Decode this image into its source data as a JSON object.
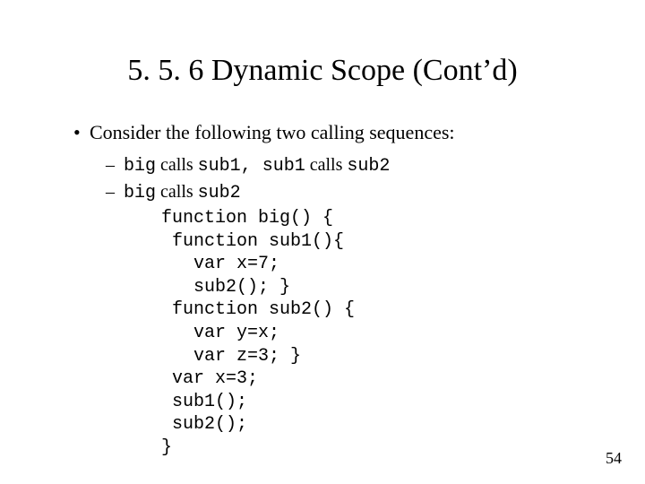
{
  "title": "5. 5. 6 Dynamic Scope (Cont’d)",
  "bullet": "Consider the following two calling sequences:",
  "seq1": {
    "a": "big",
    "calls1": " calls ",
    "b": "sub1",
    "comma": ", ",
    "c": "sub1",
    "calls2": " calls ",
    "d": "sub2"
  },
  "seq2": {
    "a": "big",
    "calls1": " calls ",
    "b": "sub2"
  },
  "code": "function big() {\n function sub1(){\n   var x=7;\n   sub2(); }\n function sub2() {\n   var y=x;\n   var z=3; }\n var x=3;\n sub1();\n sub2();\n}",
  "page": "54"
}
